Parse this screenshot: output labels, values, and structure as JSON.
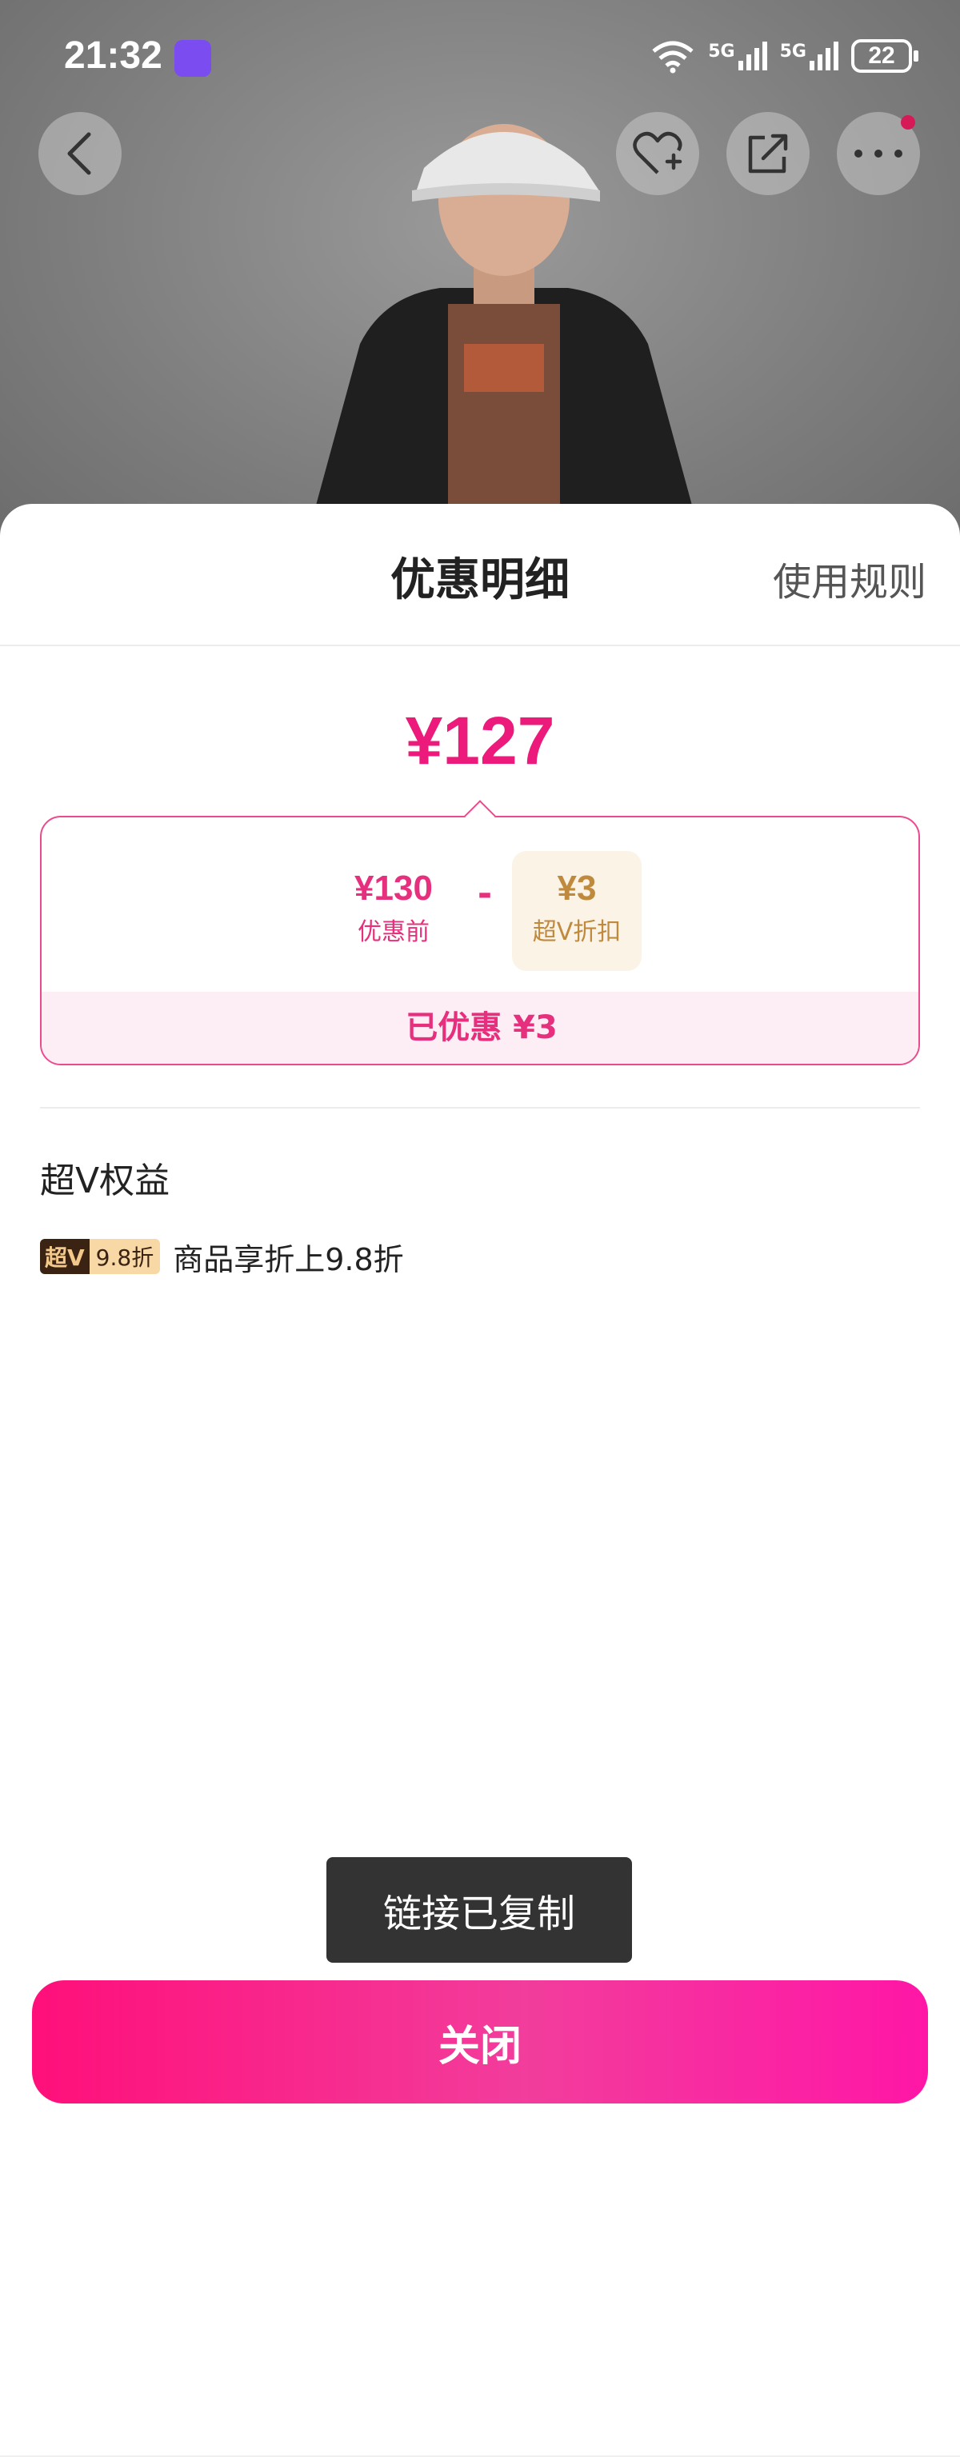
{
  "status_bar": {
    "time": "21:32",
    "network_1": "5G",
    "network_2": "5G",
    "battery": "22"
  },
  "header": {
    "title": "优惠明细",
    "rules_link": "使用规则"
  },
  "price": {
    "final": "¥127",
    "before_amount": "¥130",
    "before_label": "优惠前",
    "minus": "-",
    "discount_amount": "¥3",
    "discount_label": "超V折扣",
    "saved_text": "已优惠 ¥3"
  },
  "benefits": {
    "section_title": "超V权益",
    "tag_brand": "超V",
    "tag_discount": "9.8折",
    "description": "商品享折上9.8折"
  },
  "toast": "链接已复制",
  "close_button": "关闭",
  "colors": {
    "accent": "#ec1a7a",
    "discount_gold": "#c08a3e",
    "button_gradient_start": "#ff0f7a",
    "button_gradient_end": "#ff16a6"
  }
}
